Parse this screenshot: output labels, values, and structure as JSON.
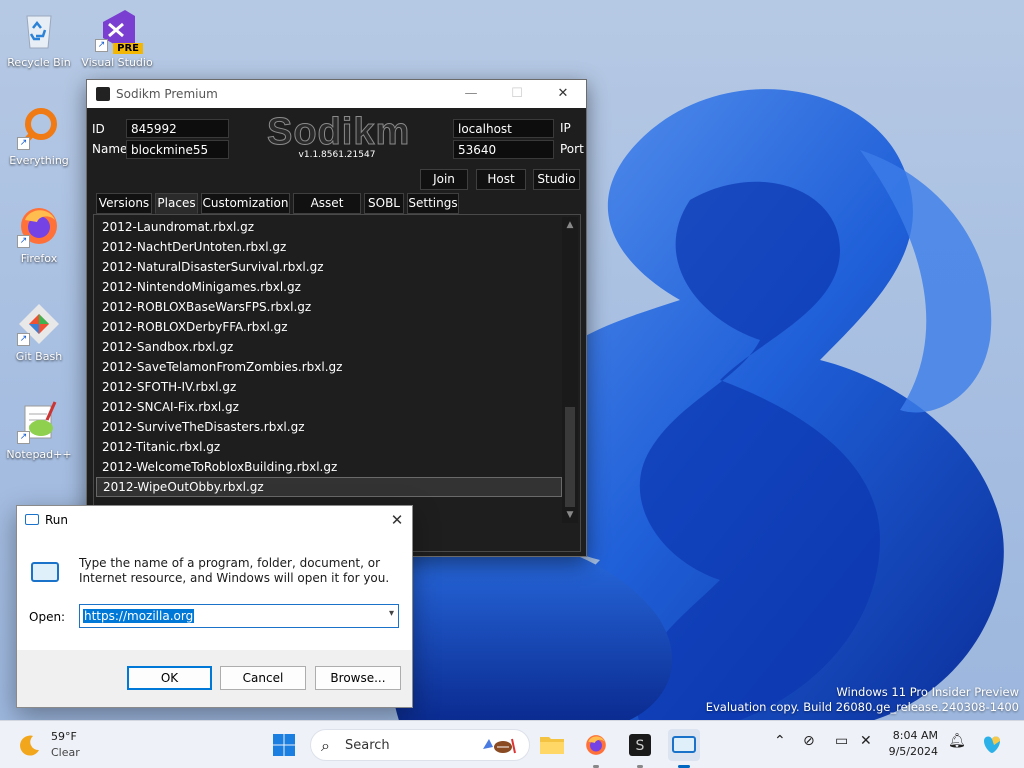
{
  "desktop": {
    "icons": [
      {
        "label": "Recycle Bin",
        "icon": "recycle-bin-icon"
      },
      {
        "label": "Visual Studio",
        "badge": "PRE",
        "icon": "visual-studio-icon"
      },
      {
        "label": "Everything",
        "icon": "everything-search-icon"
      },
      {
        "label": "Firefox",
        "icon": "firefox-icon"
      },
      {
        "label": "Git Bash",
        "icon": "git-bash-icon"
      },
      {
        "label": "Notepad++",
        "icon": "notepad-plus-plus-icon"
      }
    ]
  },
  "sodikm": {
    "window_title": "Sodikm Premium",
    "id_label": "ID",
    "id_value": "845992",
    "name_label": "Name",
    "name_value": "blockmine55",
    "logo_text": "Sodikm",
    "version": "v1.1.8561.21547",
    "ip_value": "localhost",
    "ip_label": "IP",
    "port_value": "53640",
    "port_label": "Port",
    "buttons": {
      "join": "Join",
      "host": "Host",
      "studio": "Studio"
    },
    "tabs": [
      "Versions",
      "Places",
      "Customization",
      "Asset Packs",
      "SOBL",
      "Settings"
    ],
    "active_tab": "Places",
    "places": [
      "2012-Laundromat.rbxl.gz",
      "2012-NachtDerUntoten.rbxl.gz",
      "2012-NaturalDisasterSurvival.rbxl.gz",
      "2012-NintendoMinigames.rbxl.gz",
      "2012-ROBLOXBaseWarsFPS.rbxl.gz",
      "2012-ROBLOXDerbyFFA.rbxl.gz",
      "2012-Sandbox.rbxl.gz",
      "2012-SaveTelamonFromZombies.rbxl.gz",
      "2012-SFOTH-IV.rbxl.gz",
      "2012-SNCAI-Fix.rbxl.gz",
      "2012-SurviveTheDisasters.rbxl.gz",
      "2012-Titanic.rbxl.gz",
      "2012-WelcomeToRobloxBuilding.rbxl.gz",
      "2012-WipeOutObby.rbxl.gz"
    ],
    "selected_place": "2012-WipeOutObby.rbxl.gz"
  },
  "run_dialog": {
    "title": "Run",
    "description": "Type the name of a program, folder, document, or Internet resource, and Windows will open it for you.",
    "open_label": "Open:",
    "open_value": "https://mozilla.org",
    "ok": "OK",
    "cancel": "Cancel",
    "browse": "Browse..."
  },
  "watermark": {
    "line1": "Windows 11 Pro Insider Preview",
    "line2": "Evaluation copy. Build 26080.ge_release.240308-1400"
  },
  "taskbar": {
    "weather_temp": "59°F",
    "weather_cond": "Clear",
    "search_placeholder": "Search",
    "time": "8:04 AM",
    "date": "9/5/2024"
  },
  "colors": {
    "accent": "#0078d7",
    "sodikm_bg": "#1e1e1e",
    "wallpaper_blue": "#1f5fd8"
  }
}
